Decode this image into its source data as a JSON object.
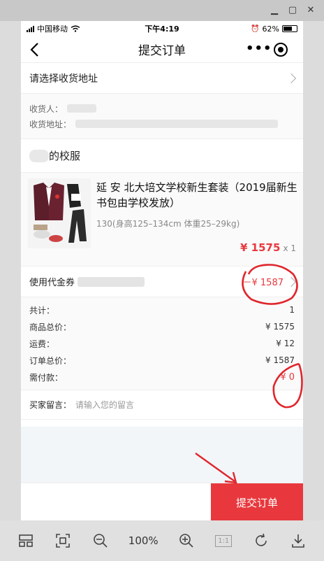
{
  "status_bar": {
    "carrier": "中国移动",
    "time": "下午4:19",
    "battery": "62%"
  },
  "nav": {
    "title": "提交订单"
  },
  "address": {
    "prompt": "请选择收货地址"
  },
  "receiver": {
    "name_label": "收货人：",
    "address_label": "收货地址："
  },
  "shop": {
    "name": "的校服"
  },
  "product": {
    "title": "延 安 北大培文学校新生套装（2019届新生书包由学校发放）",
    "spec": "130(身高125–134cm 体重25–29kg)",
    "price": "¥ 1575",
    "qty": "x 1"
  },
  "voucher": {
    "label": "使用代金券",
    "value": "－¥ 1587"
  },
  "summary": [
    {
      "label": "共计：",
      "value": "1"
    },
    {
      "label": "商品总价：",
      "value": "¥ 1575"
    },
    {
      "label": "运费：",
      "value": "¥ 12"
    },
    {
      "label": "订单总价：",
      "value": "¥ 1587"
    },
    {
      "label": "需付款：",
      "value": "¥ 0"
    }
  ],
  "message": {
    "label": "买家留言：",
    "placeholder": "请输入您的留言"
  },
  "submit": {
    "label": "提交订单"
  },
  "viewer": {
    "zoom": "100%",
    "actual_size": "1:1"
  },
  "colors": {
    "accent": "#e8383d",
    "annotation": "#e0262c"
  }
}
